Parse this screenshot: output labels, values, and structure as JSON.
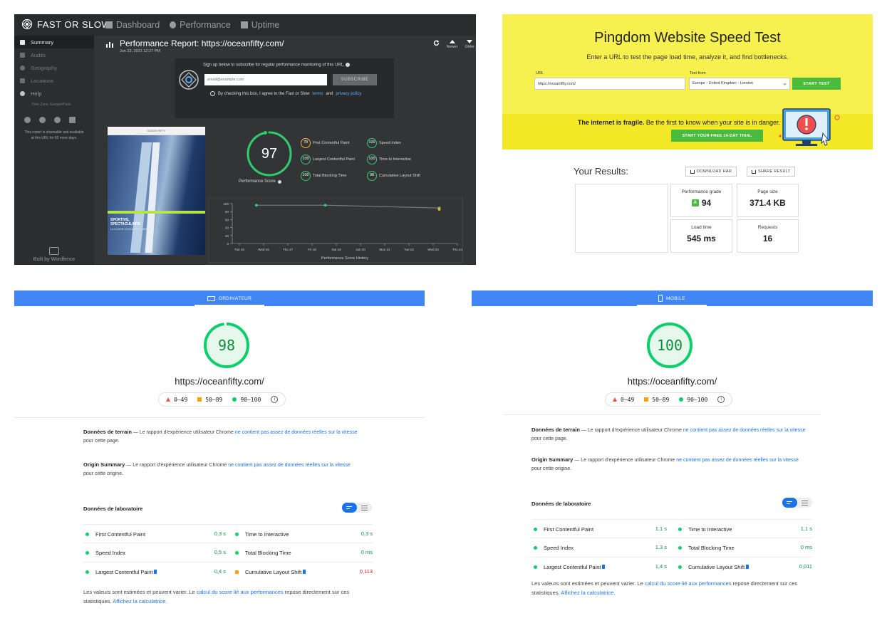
{
  "fast_or_slow": {
    "logo": "FAST OR SLOW",
    "nav": [
      "Dashboard",
      "Performance",
      "Uptime"
    ],
    "sidebar": [
      "Summary",
      "Audits",
      "Geography",
      "Locations",
      "Help"
    ],
    "timezone": "Time Zone: Europe/Paris",
    "share_note_1": "This report is shareable and available",
    "share_note_2": "at this URL for 92 more days.",
    "built_by": "Built by Wordfence",
    "report_title": "Performance Report: https://oceanfifty.com/",
    "report_date": "Jun 23, 2021 12:27 PM",
    "newer": "Newer",
    "older": "Older",
    "signup_text": "Sign up below to subscribe for regular performance monitoring of this URL.",
    "email_placeholder": "email@example.com",
    "subscribe": "SUBSCRIBE",
    "agree_text": "By checking this box, I agree to the Fast or Slow",
    "terms": "terms",
    "and": "and",
    "privacy": "privacy policy",
    "thumb_caption": "SPORTIVE, SPECTACULAIRE",
    "thumb_sub": "LA CLASSE OCEAN FIFTY ARRIVE",
    "score": "97",
    "score_label": "Performance Score",
    "metrics": [
      {
        "value": "78",
        "label": "First Contentful Paint"
      },
      {
        "value": "100",
        "label": "Speed Index"
      },
      {
        "value": "100",
        "label": "Largest Contentful Paint"
      },
      {
        "value": "100",
        "label": "Time to Interactive"
      },
      {
        "value": "100",
        "label": "Total Blocking Time"
      },
      {
        "value": "98",
        "label": "Cumulative Layout Shift"
      }
    ],
    "history_title": "Performance Score History",
    "history_y": [
      "100",
      "80",
      "60",
      "40",
      "20",
      "0"
    ],
    "history_x": [
      "Tue 15",
      "Wed 16",
      "Thu 17",
      "Fri 18",
      "Sat 19",
      "Jun 20",
      "Mon 21",
      "Tue 22",
      "Wed 23",
      "Thu 24"
    ],
    "history_points": [
      96,
      96,
      89
    ]
  },
  "pingdom": {
    "title": "Pingdom Website Speed Test",
    "subtitle": "Enter a URL to test the page load time, analyze it, and find bottlenecks.",
    "url_label": "URL",
    "url_value": "https://oceanfifty.com/",
    "from_label": "Test from",
    "from_value": "Europe - United Kingdom - London",
    "start": "START TEST",
    "fragile_bold": "The internet is fragile.",
    "fragile_rest": "Be the first to know when your site is in danger.",
    "trial": "START YOUR FREE 14-DAY TRIAL",
    "results": "Your Results:",
    "download": "DOWNLOAD HAR",
    "share": "SHARE RESULT",
    "grade_label": "Performance grade",
    "grade_letter": "A",
    "grade_value": "94",
    "size_label": "Page size",
    "size_value": "371.4 KB",
    "load_label": "Load time",
    "load_value": "545 ms",
    "req_label": "Requests",
    "req_value": "16"
  },
  "psi_desktop": {
    "tab": "ORDINATEUR",
    "score": "98",
    "url": "https://oceanfifty.com/",
    "legend": [
      "0–49",
      "50–89",
      "90–100"
    ],
    "terrain_title": "Données de terrain",
    "terrain_text": " — Le rapport d'expérience utilisateur Chrome ",
    "terrain_link": "ne contient pas assez de données réelles sur la vitesse",
    "terrain_end": " pour cette page.",
    "origin_title": "Origin Summary",
    "origin_text": " — Le rapport d'expérience utilisateur Chrome ",
    "origin_link": "ne contient pas assez de données réelles sur la vitesse",
    "origin_end": " pour cette origine.",
    "lab_title": "Données de laboratoire",
    "rows": [
      {
        "l": "First Contentful Paint",
        "lv": "0,3 s",
        "r": "Time to Interactive",
        "rv": "0,3 s"
      },
      {
        "l": "Speed Index",
        "lv": "0,5 s",
        "r": "Total Blocking Time",
        "rv": "0 ms"
      },
      {
        "l": "Largest Contentful Paint",
        "lv": "0,4 s",
        "r": "Cumulative Layout Shift",
        "rv": "0,113"
      }
    ],
    "note_1": "Les valeurs sont estimées et peuvent varier. Le ",
    "note_link": "calcul du score lié aux performances",
    "note_2": " repose directement sur ces statistiques. ",
    "note_link2": "Affichez la calculatrice."
  },
  "psi_mobile": {
    "tab": "MOBILE",
    "score": "100",
    "url": "https://oceanfifty.com/",
    "legend": [
      "0–49",
      "50–89",
      "90–100"
    ],
    "terrain_title": "Données de terrain",
    "terrain_text": " — Le rapport d'expérience utilisateur Chrome ",
    "terrain_link": "ne contient pas assez de données réelles sur la vitesse",
    "terrain_end": " pour cette page.",
    "origin_title": "Origin Summary",
    "origin_text": " — Le rapport d'expérience utilisateur Chrome ",
    "origin_link": "ne contient pas assez de données réelles sur la vitesse",
    "origin_end": " pour cette origine.",
    "lab_title": "Données de laboratoire",
    "rows": [
      {
        "l": "First Contentful Paint",
        "lv": "1,1 s",
        "r": "Time to Interactive",
        "rv": "1,1 s"
      },
      {
        "l": "Speed Index",
        "lv": "1,3 s",
        "r": "Total Blocking Time",
        "rv": "0 ms"
      },
      {
        "l": "Largest Contentful Paint",
        "lv": "1,4 s",
        "r": "Cumulative Layout Shift",
        "rv": "0,011"
      }
    ],
    "note_1": "Les valeurs sont estimées et peuvent varier. Le ",
    "note_link": "calcul du score lié aux performances",
    "note_2": " repose directement sur ces statistiques. ",
    "note_link2": "Affichez la calculatrice."
  }
}
